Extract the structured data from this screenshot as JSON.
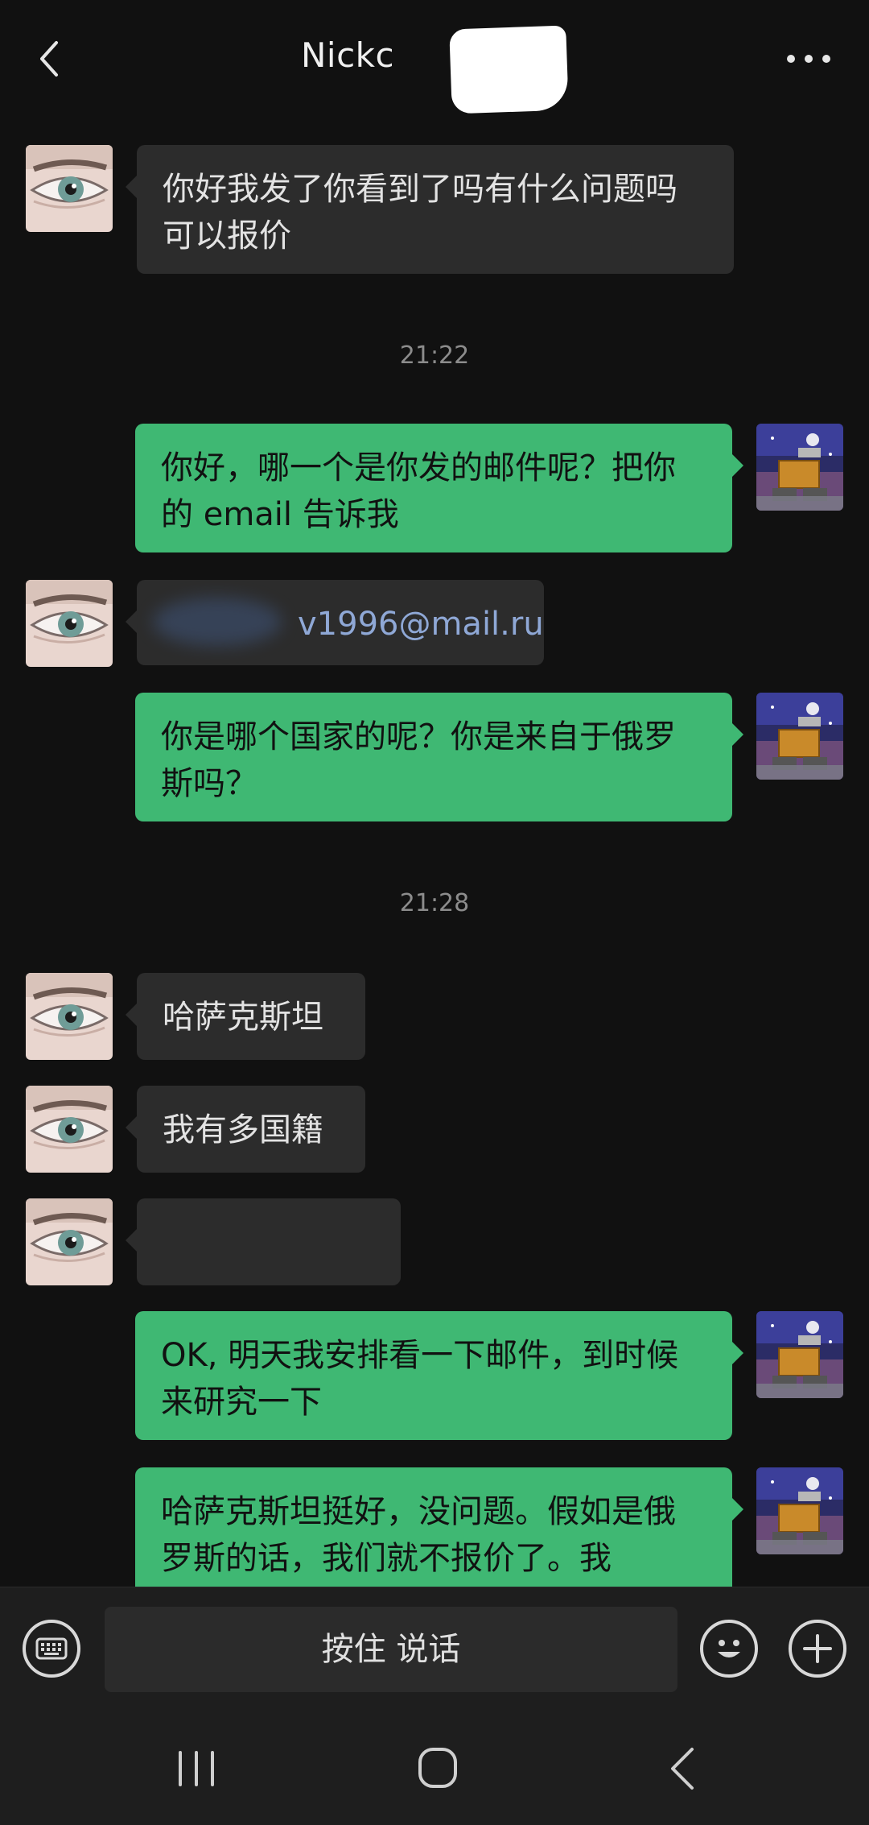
{
  "header": {
    "title": "Nickc"
  },
  "messages": [
    {
      "side": "in",
      "text": "你好我发了你看到了吗有什么问题吗可以报价"
    },
    {
      "type": "time",
      "text": "21:22"
    },
    {
      "side": "out",
      "text": "你好，哪一个是你发的邮件呢？把你的 email 告诉我"
    },
    {
      "side": "in",
      "text": "v1996@mail.ru"
    },
    {
      "side": "out",
      "text": "你是哪个国家的呢？你是来自于俄罗斯吗？"
    },
    {
      "type": "time",
      "text": "21:28"
    },
    {
      "side": "in",
      "text": "哈萨克斯坦"
    },
    {
      "side": "in",
      "text": "我有多国籍"
    },
    {
      "side": "in",
      "text": ""
    },
    {
      "side": "out",
      "text": "OK, 明天我安排看一下邮件，到时候来研究一下"
    },
    {
      "side": "out",
      "text": "哈萨克斯坦挺好，没问题。假如是俄罗斯的话，我们就不报价了。我"
    }
  ],
  "input": {
    "voice_label": "按住 说话"
  },
  "colors": {
    "background": "#111111",
    "incoming_bubble": "#2c2c2c",
    "outgoing_bubble": "#3fb873",
    "bar": "#1e1e1e"
  },
  "icons": [
    "back-icon",
    "more-icon",
    "keyboard-icon",
    "emoji-icon",
    "plus-icon",
    "recent-apps-icon",
    "home-icon",
    "system-back-icon"
  ]
}
